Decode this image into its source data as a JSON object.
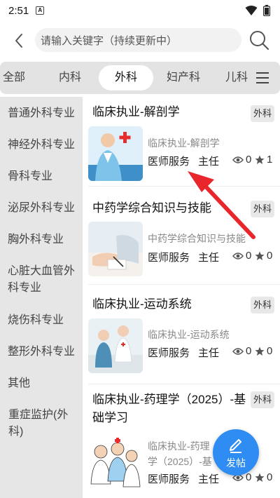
{
  "status_bar": {
    "time": "2:51",
    "notification_badge": "A"
  },
  "search": {
    "placeholder": "请输入关键字（持续更新中）"
  },
  "tabs": [
    {
      "label": "全部",
      "active": false
    },
    {
      "label": "内科",
      "active": false
    },
    {
      "label": "外科",
      "active": true
    },
    {
      "label": "妇产科",
      "active": false
    },
    {
      "label": "儿科",
      "active": false
    }
  ],
  "sidebar": {
    "items": [
      "普通外科专业",
      "神经外科专业",
      "骨科专业",
      "泌尿外科专业",
      "胸外科专业",
      "心脏大血管外科专业",
      "烧伤科专业",
      "整形外科专业",
      "其他",
      "重症监护(外科)"
    ]
  },
  "cards": [
    {
      "title": "临床执业-解剖学",
      "tag": "外科",
      "subtitle": "临床执业-解剖学",
      "service": "医师服务",
      "role": "主任",
      "views": "0",
      "stars": "1"
    },
    {
      "title": "中药学综合知识与技能",
      "tag": "外科",
      "subtitle": "中药学综合知识与技能",
      "service": "医师服务",
      "role": "主任",
      "views": "0",
      "stars": "0"
    },
    {
      "title": "临床执业-运动系统",
      "tag": "外科",
      "subtitle": "临床执业-运动系统",
      "service": "医师服务",
      "role": "主任",
      "views": "0",
      "stars": "0"
    },
    {
      "title": "临床执业-药理学（2025）-基础学习",
      "tag": "外科",
      "subtitle": "临床执业-药理学（2025）-基础",
      "service": "医师服务",
      "role": "主任",
      "views": "0",
      "stars": "0"
    }
  ],
  "fab": {
    "label": "发帖"
  },
  "colors": {
    "accent": "#2f8cf2",
    "arrow": "#e8262b",
    "sidebar_bg": "#e6e6e6",
    "tab_bar_bg": "#e3e3e3"
  },
  "icons": [
    "back-arrow-icon",
    "search-icon",
    "menu-icon",
    "eye-icon",
    "star-icon",
    "edit-pencil-icon",
    "wifi-icon",
    "battery-icon"
  ]
}
